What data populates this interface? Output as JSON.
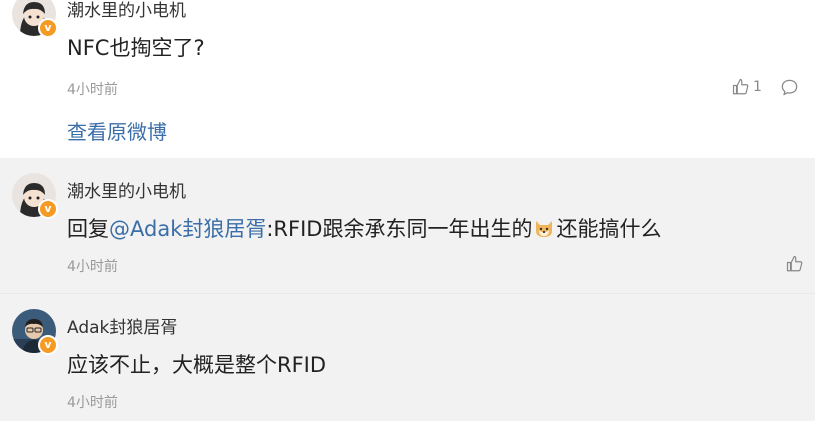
{
  "comments": [
    {
      "username": "潮水里的小电机",
      "content": "NFC也掏空了?",
      "time": "4小时前",
      "likes": "1",
      "view_original": "查看原微博"
    },
    {
      "username": "潮水里的小电机",
      "reply_prefix": "回复",
      "mention": "@Adak封狼居胥",
      "reply_text_1": ":RFID跟余承东同一年出生的",
      "reply_text_2": "还能搞什么",
      "time": "4小时前"
    },
    {
      "username": "Adak封狼居胥",
      "content": "应该不止，大概是整个RFID",
      "time": "4小时前"
    }
  ],
  "icons": {
    "like": "thumbs-up-icon",
    "comment": "comment-bubble-icon",
    "verified": "verified-badge-icon",
    "emoji": "shiba-dog-emoji"
  },
  "colors": {
    "link": "#3b6ea8",
    "badge": "#f59a22",
    "reply_bg": "#f2f2f2"
  }
}
